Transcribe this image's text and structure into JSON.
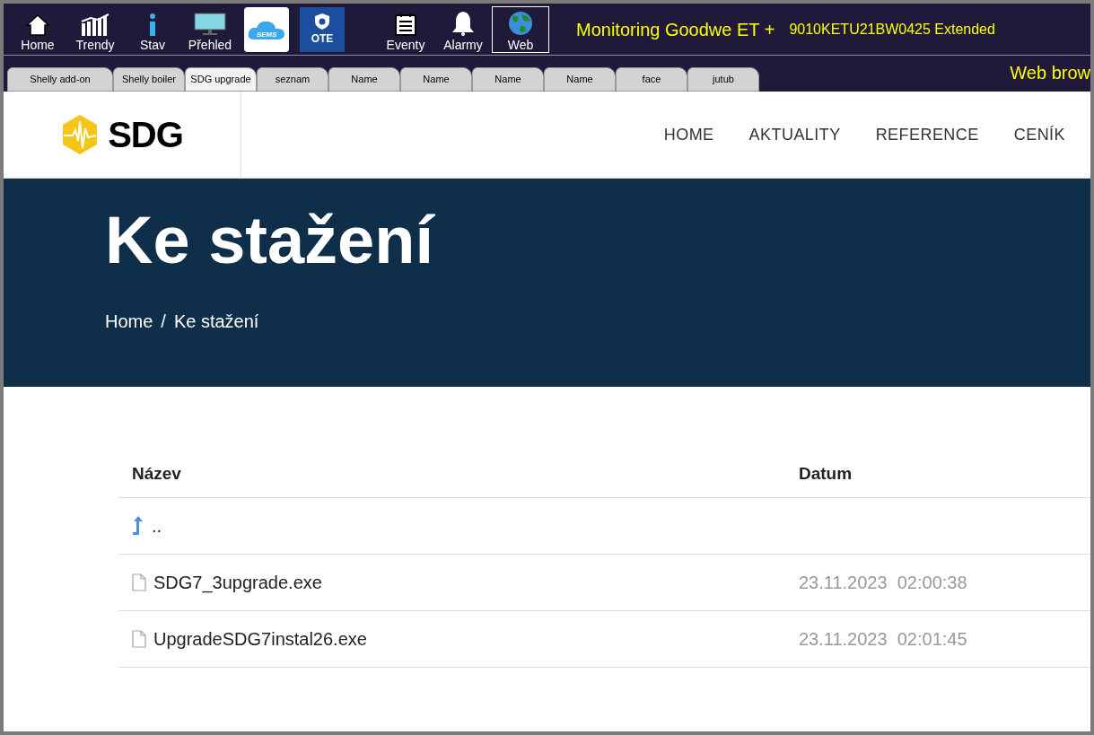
{
  "toolbar": {
    "items": [
      {
        "kind": "icon",
        "label": "Home",
        "selected": false
      },
      {
        "kind": "icon",
        "label": "Trendy",
        "selected": false
      },
      {
        "kind": "icon",
        "label": "Stav",
        "selected": false
      },
      {
        "kind": "icon",
        "label": "Přehled",
        "selected": false
      },
      {
        "kind": "logo",
        "label": "SEMS",
        "selected": false
      },
      {
        "kind": "logo",
        "label": "OTE",
        "selected": false
      },
      {
        "kind": "icon",
        "label": "Eventy",
        "selected": false
      },
      {
        "kind": "icon",
        "label": "Alarmy",
        "selected": false
      },
      {
        "kind": "icon",
        "label": "Web",
        "selected": true
      }
    ],
    "title": "Monitoring Goodwe ET +",
    "serial": "9010KETU21BW0425 Extended"
  },
  "tabs": {
    "items": [
      {
        "label": "Shelly add-on",
        "selected": false
      },
      {
        "label": "Shelly boiler",
        "selected": false
      },
      {
        "label": "SDG upgrade",
        "selected": true
      },
      {
        "label": "seznam",
        "selected": false
      },
      {
        "label": "Name",
        "selected": false
      },
      {
        "label": "Name",
        "selected": false
      },
      {
        "label": "Name",
        "selected": false
      },
      {
        "label": "Name",
        "selected": false
      },
      {
        "label": "face",
        "selected": false
      },
      {
        "label": "jutub",
        "selected": false
      }
    ],
    "caption": "Web brow"
  },
  "web": {
    "logo": "SDG",
    "nav": [
      "HOME",
      "AKTUALITY",
      "REFERENCE",
      "CENÍK"
    ],
    "hero": {
      "title": "Ke stažení",
      "breadcrumb": [
        "Home",
        "/",
        "Ke stažení"
      ]
    },
    "table": {
      "columns": [
        "Název",
        "Datum"
      ],
      "rows": [
        {
          "kind": "parent",
          "name": "..",
          "date": ""
        },
        {
          "kind": "file",
          "name": "SDG7_3upgrade.exe",
          "date": "23.11.2023  02:00:38"
        },
        {
          "kind": "file",
          "name": "UpgradeSDG7instal26.exe",
          "date": "23.11.2023  02:01:45"
        }
      ]
    }
  }
}
